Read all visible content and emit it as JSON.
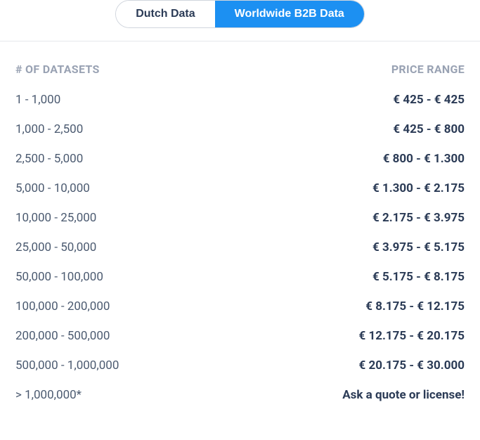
{
  "tabs": {
    "dutch_label": "Dutch Data",
    "worldwide_label": "Worldwide B2B Data"
  },
  "headers": {
    "datasets": "# OF DATASETS",
    "price": "PRICE RANGE"
  },
  "rows": [
    {
      "datasets": "1 - 1,000",
      "price": "€ 425 - € 425"
    },
    {
      "datasets": "1,000 - 2,500",
      "price": "€ 425 - € 800"
    },
    {
      "datasets": "2,500 - 5,000",
      "price": "€ 800 - € 1.300"
    },
    {
      "datasets": "5,000 - 10,000",
      "price": "€ 1.300 - € 2.175"
    },
    {
      "datasets": "10,000 - 25,000",
      "price": "€ 2.175 - € 3.975"
    },
    {
      "datasets": "25,000 - 50,000",
      "price": "€ 3.975 - € 5.175"
    },
    {
      "datasets": "50,000 - 100,000",
      "price": "€ 5.175 - € 8.175"
    },
    {
      "datasets": "100,000 - 200,000",
      "price": "€ 8.175 - € 12.175"
    },
    {
      "datasets": "200,000 - 500,000",
      "price": "€ 12.175 - € 20.175"
    },
    {
      "datasets": "500,000 - 1,000,000",
      "price": "€ 20.175 - € 30.000"
    },
    {
      "datasets": "> 1,000,000*",
      "price": "Ask a quote or license!"
    }
  ]
}
